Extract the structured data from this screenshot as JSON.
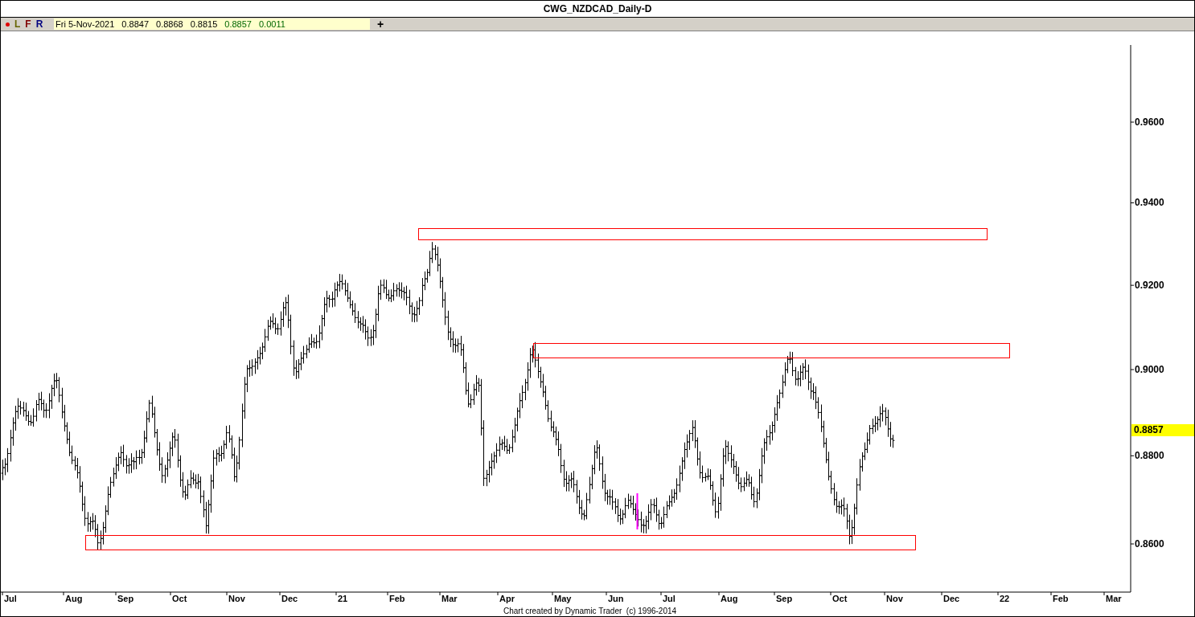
{
  "window": {
    "title": "CWG_NZDCAD_Daily-D"
  },
  "toolbar": {
    "buttons": [
      {
        "kind": "dot"
      },
      {
        "kind": "letter",
        "label": "L",
        "color": "#666600"
      },
      {
        "kind": "letter",
        "label": "F",
        "color": "#800000"
      },
      {
        "kind": "letter",
        "label": "R",
        "color": "#000080"
      }
    ],
    "quote": [
      {
        "text": "Fri 5-Nov-2021",
        "kind": "date"
      },
      {
        "text": "0.8847",
        "kind": "open"
      },
      {
        "text": "0.8868",
        "kind": "high"
      },
      {
        "text": "0.8815",
        "kind": "low"
      },
      {
        "text": "0.8857",
        "kind": "close"
      },
      {
        "text": "0.0011",
        "kind": "change"
      }
    ],
    "add_button": "+"
  },
  "chart": {
    "y_axis": [
      "0.9600",
      "0.9400",
      "0.9200",
      "0.9000",
      "0.8800",
      "0.8600"
    ],
    "last_price": "0.8857",
    "x_axis": [
      "Jul",
      "Aug",
      "Sep",
      "Oct",
      "Nov",
      "Dec",
      "21",
      "Feb",
      "Mar",
      "Apr",
      "May",
      "Jun",
      "Jul",
      "Aug",
      "Sep",
      "Oct",
      "Nov",
      "Dec",
      "22",
      "Feb",
      "Mar"
    ]
  },
  "footer": "Chart created by Dynamic Trader  (c) 1996-2014"
}
